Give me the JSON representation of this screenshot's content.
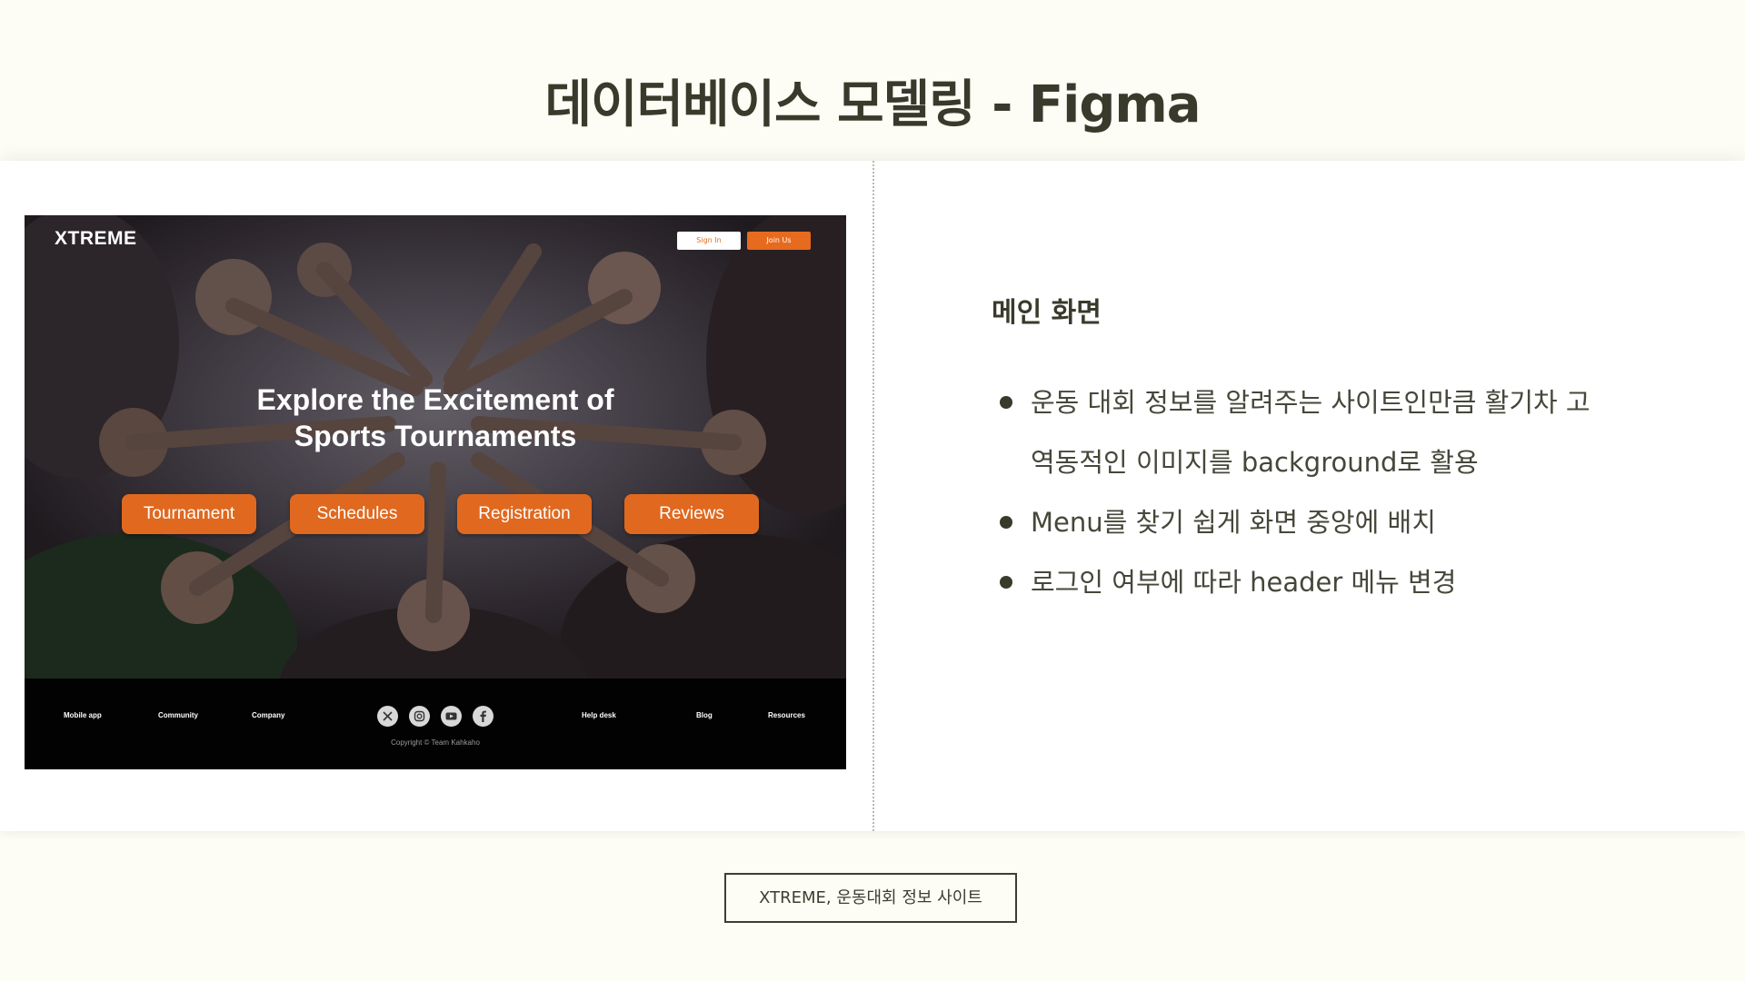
{
  "slide": {
    "title": "데이터베이스 모델링 - Figma",
    "caption": "XTREME, 운동대회 정보 사이트"
  },
  "mockup": {
    "brand": "XTREME",
    "signin_label": "Sign In",
    "joinus_label": "Join Us",
    "hero_heading_line1": "Explore the Excitement of",
    "hero_heading_line2": "Sports Tournaments",
    "menu": [
      {
        "label": "Tournament"
      },
      {
        "label": "Schedules"
      },
      {
        "label": "Registration"
      },
      {
        "label": "Reviews"
      }
    ],
    "footer_left": [
      {
        "label": "Mobile app"
      },
      {
        "label": "Community"
      },
      {
        "label": "Company"
      }
    ],
    "footer_right": [
      {
        "label": "Help desk"
      },
      {
        "label": "Blog"
      },
      {
        "label": "Resources"
      }
    ],
    "social_icons": [
      "x-icon",
      "instagram-icon",
      "youtube-icon",
      "facebook-icon"
    ],
    "copyright": "Copyright © Team Kahkaho",
    "colors": {
      "accent": "#e0691f",
      "footer_bg": "#020202"
    }
  },
  "description": {
    "heading": "메인 화면",
    "bullets": [
      {
        "text": "운동 대회 정보를 알려주는 사이트인만큼 활기차 고 역동적인 이미지를 background로 활용"
      },
      {
        "text": "Menu를 찾기 쉽게 화면 중앙에 배치"
      },
      {
        "text": "로그인 여부에 따라 header 메뉴 변경"
      }
    ]
  },
  "colors": {
    "page_bg": "#fdfdf5",
    "panel_bg": "#ffffff",
    "text": "#3a3a2c"
  }
}
